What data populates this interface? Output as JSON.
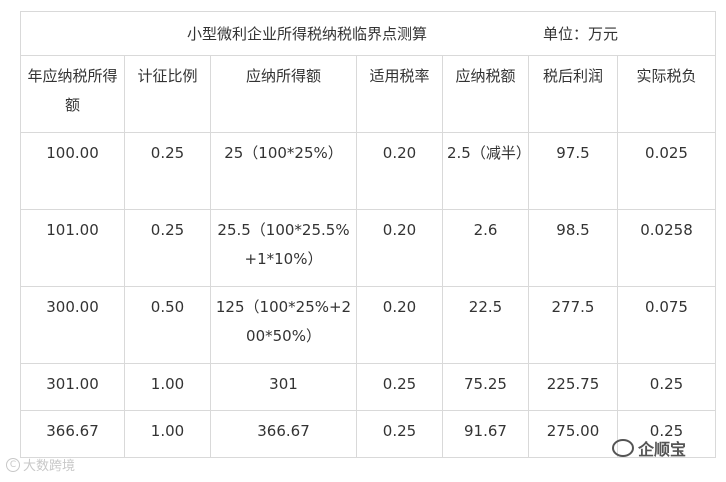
{
  "table": {
    "title": "小型微利企业所得税纳税临界点测算",
    "unit": "单位：万元",
    "headers": [
      "年应纳税所得额",
      "计征比例",
      "应纳所得额",
      "适用税率",
      "应纳税额",
      "税后利润",
      "实际税负"
    ],
    "rows": [
      [
        "100.00",
        "0.25",
        "25（100*25%）",
        "0.20",
        "2.5（减半）",
        "97.5",
        "0.025"
      ],
      [
        "101.00",
        "0.25",
        "25.5（100*25.5%+1*10%）",
        "0.20",
        "2.6",
        "98.5",
        "0.0258"
      ],
      [
        "300.00",
        "0.50",
        "125（100*25%+200*50%）",
        "0.20",
        "22.5",
        "277.5",
        "0.075"
      ],
      [
        "301.00",
        "1.00",
        "301",
        "0.25",
        "75.25",
        "225.75",
        "0.25"
      ],
      [
        "366.67",
        "1.00",
        "366.67",
        "0.25",
        "91.67",
        "275.00",
        "0.25"
      ]
    ]
  },
  "highlight_colors": {
    "blue": "#2eaadc",
    "orange": "#e07b39"
  },
  "watermarks": {
    "left": "大数跨境",
    "right": "企顺宝"
  }
}
